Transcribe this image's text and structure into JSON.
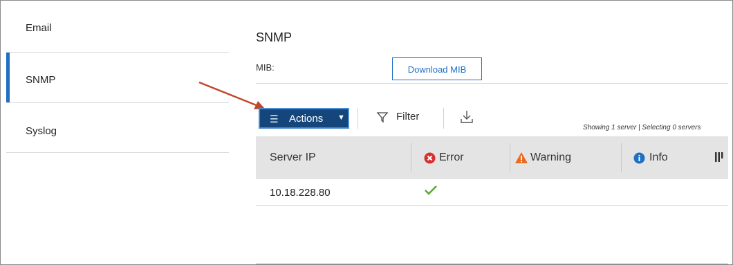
{
  "sidebar": {
    "items": [
      {
        "label": "Email"
      },
      {
        "label": "SNMP",
        "selected": true
      },
      {
        "label": "Syslog"
      }
    ]
  },
  "main": {
    "title": "SNMP",
    "mib_label": "MIB:",
    "download_button": "Download MIB",
    "toolbar": {
      "actions_label": "Actions",
      "filter_label": "Filter",
      "download_icon": "download-icon",
      "showing_text": "Showing 1 server | Selecting 0 servers"
    },
    "table": {
      "columns": [
        "Server IP",
        "Error",
        "Warning",
        "Info"
      ],
      "rows": [
        {
          "server_ip": "10.18.228.80",
          "error": "check",
          "warning": "",
          "info": ""
        }
      ]
    }
  },
  "colors": {
    "accent": "#1f70c1",
    "actions_bg": "#15467b",
    "error": "#d62f2f",
    "warning": "#ea6a1e",
    "info": "#1f70c1",
    "check": "#5aa632",
    "annotation_arrow": "#c0492b"
  }
}
